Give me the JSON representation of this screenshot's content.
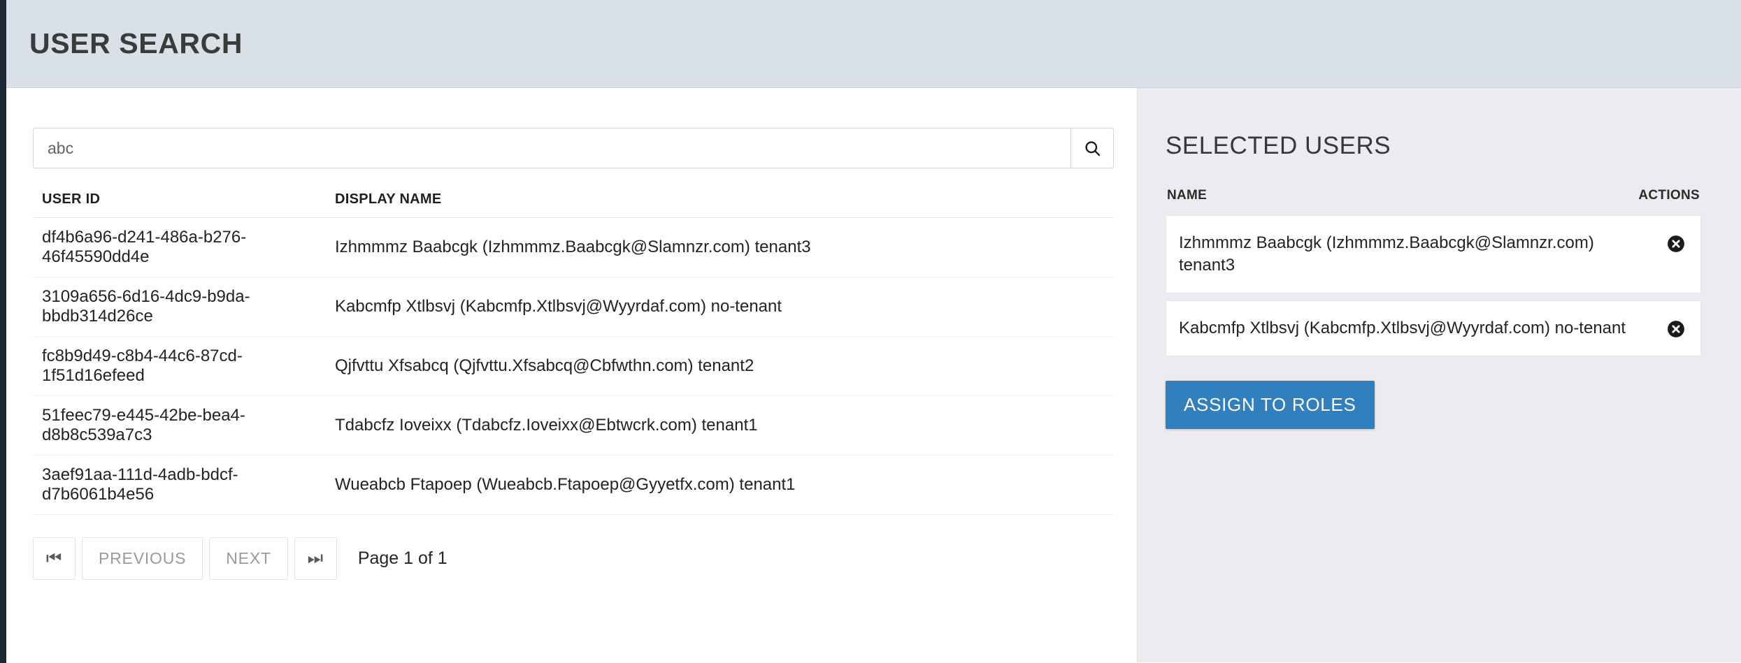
{
  "header": {
    "title": "USER SEARCH"
  },
  "search": {
    "value": "abc",
    "placeholder": "",
    "button_icon": "search-icon"
  },
  "results": {
    "columns": {
      "user_id": "USER ID",
      "display_name": "DISPLAY NAME"
    },
    "rows": [
      {
        "user_id": "df4b6a96-d241-486a-b276-46f45590dd4e",
        "display_name": "Izhmmmz Baabcgk (Izhmmmz.Baabcgk@Slamnzr.com) tenant3"
      },
      {
        "user_id": "3109a656-6d16-4dc9-b9da-bbdb314d26ce",
        "display_name": "Kabcmfp Xtlbsvj (Kabcmfp.Xtlbsvj@Wyyrdaf.com) no-tenant"
      },
      {
        "user_id": "fc8b9d49-c8b4-44c6-87cd-1f51d16efeed",
        "display_name": "Qjfvttu Xfsabcq (Qjfvttu.Xfsabcq@Cbfwthn.com) tenant2"
      },
      {
        "user_id": "51feec79-e445-42be-bea4-d8b8c539a7c3",
        "display_name": "Tdabcfz Ioveixx (Tdabcfz.Ioveixx@Ebtwcrk.com) tenant1"
      },
      {
        "user_id": "3aef91aa-111d-4adb-bdcf-d7b6061b4e56",
        "display_name": "Wueabcb Ftapoep (Wueabcb.Ftapoep@Gyyetfx.com) tenant1"
      }
    ]
  },
  "pagination": {
    "first_label": "⏮",
    "previous_label": "PREVIOUS",
    "next_label": "NEXT",
    "last_label": "⏭",
    "page_info": "Page 1 of 1"
  },
  "selected": {
    "title": "SELECTED USERS",
    "columns": {
      "name": "NAME",
      "actions": "ACTIONS"
    },
    "items": [
      {
        "name": "Izhmmmz Baabcgk (Izhmmmz.Baabcgk@Slamnzr.com) tenant3",
        "remove_icon": "remove-circle-icon"
      },
      {
        "name": "Kabcmfp Xtlbsvj (Kabcmfp.Xtlbsvj@Wyyrdaf.com) no-tenant",
        "remove_icon": "remove-circle-icon"
      }
    ],
    "assign_label": "ASSIGN TO ROLES"
  },
  "colors": {
    "header_bg": "#d9e0e8",
    "panel_bg": "#ebecf0",
    "accent": "#3180bd",
    "edge": "#1b2733"
  }
}
